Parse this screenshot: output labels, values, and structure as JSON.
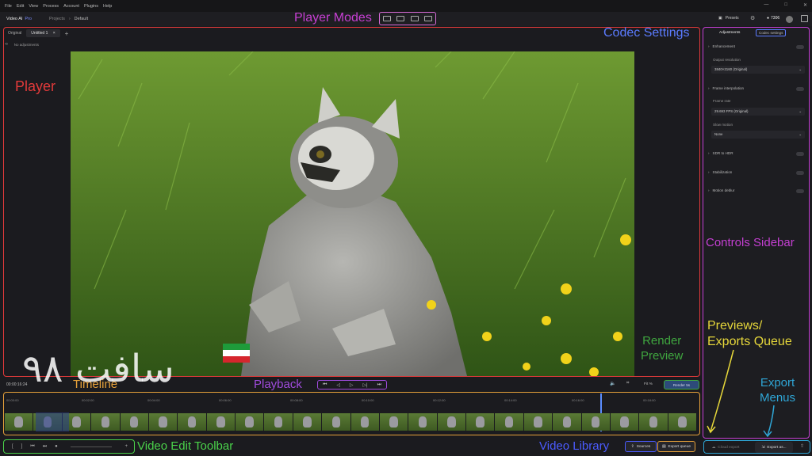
{
  "menubar": {
    "items": [
      "File",
      "Edit",
      "View",
      "Process",
      "Account",
      "Plugins",
      "Help"
    ],
    "window_controls": [
      "—",
      "□",
      "✕"
    ]
  },
  "appbar": {
    "app_name": "Video AI",
    "app_tier": "Pro",
    "breadcrumb": [
      "Projects",
      "›",
      "Default"
    ],
    "presets_label": "Presets",
    "credits": "7306"
  },
  "tabs": {
    "items": [
      "Original",
      "Untitled 1"
    ],
    "close": "×",
    "add": "+"
  },
  "subbar": {
    "text": "No adjustments"
  },
  "sidebar": {
    "tabs": [
      "Adjustments",
      "Codec settings"
    ],
    "enhancement": "Enhancement",
    "output_resolution_label": "Output resolution",
    "output_resolution_value": "3840×2160 (Original)",
    "frame_interpolation": "Frame interpolation",
    "frame_rate_label": "Frame rate",
    "frame_rate_value": "29.693 FPS (Original)",
    "slow_motion_label": "Slow motion",
    "slow_motion_value": "None",
    "sdr_to_hdr": "SDR to HDR",
    "stabilization": "Stabilization",
    "motion_deblur": "Motion deblur"
  },
  "playback": {
    "timecode": "00:00:16:24",
    "fit": "Fit %",
    "render_button": "Render 5s"
  },
  "ruler": {
    "ticks": [
      "00:00:00",
      "00:02:00",
      "00:04:00",
      "00:06:00",
      "00:08:00",
      "00:10:00",
      "00:12:00",
      "00:14:00",
      "00:16:00",
      "00:18:00"
    ]
  },
  "toolbar": {
    "items": [
      "[",
      "]",
      "⏮",
      "⏭",
      "●",
      "+"
    ]
  },
  "buttons": {
    "sources": "Sources",
    "export_queue": "Export queue",
    "cloud_export": "Cloud export",
    "export_as": "Export as..."
  },
  "annotations": {
    "player_modes": "Player Modes",
    "codec_settings": "Codec Settings",
    "player": "Player",
    "controls_sidebar": "Controls Sidebar",
    "previews_queue": "Previews/\nExports Queue",
    "render_preview": "Render\nPreview",
    "export_menus": "Export\nMenus",
    "timeline": "Timeline",
    "playback": "Playback",
    "video_edit_toolbar": "Video Edit Toolbar",
    "video_library": "Video Library"
  },
  "watermark": {
    "text": "سافت ۹۸"
  },
  "colors": {
    "player": "#e23a3a",
    "sidebar": "#c43fd2",
    "codec": "#5b7bff",
    "timeline": "#e6a13a",
    "toolbar": "#4ad24a",
    "render": "#3fa63f",
    "export": "#2fa6d6",
    "library": "#4b5bff",
    "previews": "#e6d73a"
  }
}
